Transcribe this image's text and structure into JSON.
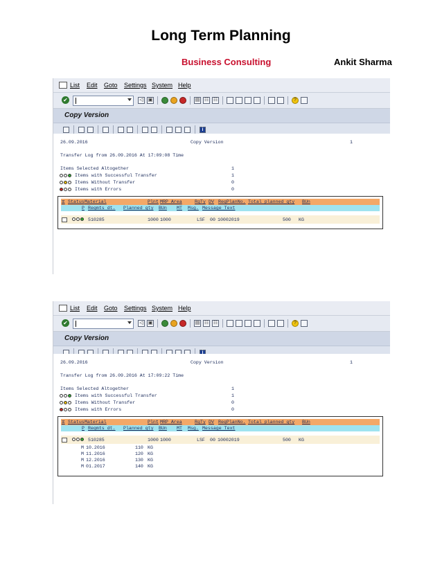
{
  "doc": {
    "title": "Long Term Planning",
    "subtitle_left": "Business Consulting",
    "subtitle_right": "Ankit Sharma",
    "subtitle_left_color": "#c8102e"
  },
  "menu": [
    "List",
    "Edit",
    "Goto",
    "Settings",
    "System",
    "Help"
  ],
  "screen_title": "Copy Version",
  "screenshots": [
    {
      "header_date": "26.09.2016",
      "header_title": "Copy Version",
      "header_page": "1",
      "transfer_log": "Transfer Log from 26.09.2016 At 17:09:08 Time",
      "stats": {
        "selected_label": "Items Selected Altogether",
        "selected": "1",
        "success_label": "Items with Successful Transfer",
        "success": "1",
        "without_label": "Items Without Transfer",
        "without": "0",
        "errors_label": "Items with Errors",
        "errors": "0"
      },
      "columns1": {
        "status": "Status",
        "material": "Material",
        "plnt": "Plnt",
        "mrp_area": "MRP Area",
        "rqty": "RqTy",
        "dv": "DV",
        "reqplanno": "ReqPlanNo.",
        "total": "Total planned qty",
        "bun": "BUn"
      },
      "columns2": {
        "p": "P",
        "reqmts": "Reqmts dt.",
        "planned": "Planned qty",
        "bun": "BUn",
        "mt": "MT",
        "msg": "Msg.",
        "text": "Message Text"
      },
      "row": {
        "material": "510285",
        "plnt": "1000",
        "mrp_area": "1000",
        "rqty": "LSF",
        "dv": "00",
        "reqplanno": "10002019",
        "total": "500",
        "bun": "KG"
      },
      "subrows": []
    },
    {
      "header_date": "26.09.2016",
      "header_title": "Copy Version",
      "header_page": "1",
      "transfer_log": "Transfer Log from 26.09.2016 At 17:09:22 Time",
      "stats": {
        "selected_label": "Items Selected Altogether",
        "selected": "1",
        "success_label": "Items with Successful Transfer",
        "success": "1",
        "without_label": "Items Without Transfer",
        "without": "0",
        "errors_label": "Items with Errors",
        "errors": "0"
      },
      "columns1": {
        "status": "Status",
        "material": "Material",
        "plnt": "Plnt",
        "mrp_area": "MRP Area",
        "rqty": "RqTy",
        "dv": "DV",
        "reqplanno": "ReqPlanNo.",
        "total": "Total planned qty",
        "bun": "BUn"
      },
      "columns2": {
        "p": "P",
        "reqmts": "Reqmts dt.",
        "planned": "Planned qty",
        "bun": "BUn",
        "mt": "MT",
        "msg": "Msg.",
        "text": "Message Text"
      },
      "row": {
        "material": "510285",
        "plnt": "1000",
        "mrp_area": "1000",
        "rqty": "LSF",
        "dv": "00",
        "reqplanno": "10002019",
        "total": "500",
        "bun": "KG"
      },
      "subrows": [
        {
          "p": "M",
          "date": "10.2016",
          "qty": "110",
          "bun": "KG"
        },
        {
          "p": "M",
          "date": "11.2016",
          "qty": "120",
          "bun": "KG"
        },
        {
          "p": "M",
          "date": "12.2016",
          "qty": "130",
          "bun": "KG"
        },
        {
          "p": "M",
          "date": "01.2017",
          "qty": "140",
          "bun": "KG"
        }
      ]
    }
  ]
}
